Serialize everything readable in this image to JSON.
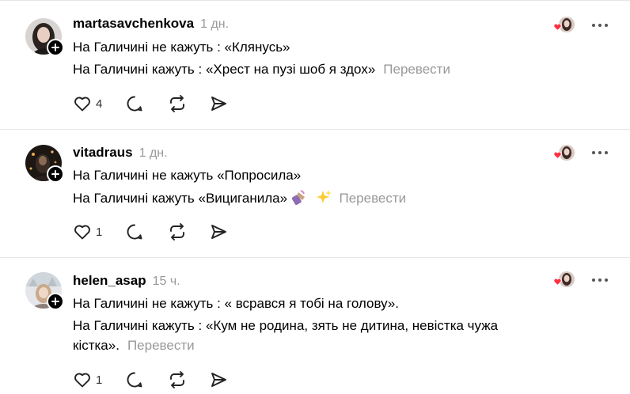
{
  "posts": [
    {
      "username": "martasavchenkova",
      "time": "1 дн.",
      "lines": [
        "На Галичині не кажуть : «Клянусь»",
        "На Галичині кажуть : «Хрест на пузі шоб я здох»"
      ],
      "translate_label": "Перевести",
      "like_count": "4",
      "avatar_icon": "avatar-photo-woman-dark-hair"
    },
    {
      "username": "vitadraus",
      "time": "1 дн.",
      "lines": [
        "На Галичині не кажуть «Попросила»",
        "На Галичині кажуть «Вициганила»"
      ],
      "line_emojis": [
        "nail-polish-emoji",
        "sparkles-emoji"
      ],
      "translate_label": "Перевести",
      "like_count": "1",
      "avatar_icon": "avatar-photo-dark-lights"
    },
    {
      "username": "helen_asap",
      "time": "15 ч.",
      "lines": [
        "На Галичині не кажуть : « всрався я тобі на голову».",
        "На Галичині кажуть : «Кум не родина, зять не дитина, невістка чужа",
        "кістка»."
      ],
      "translate_label": "Перевести",
      "like_count": "1",
      "avatar_icon": "avatar-photo-woman-light"
    }
  ],
  "icons": {
    "like": "heart-icon",
    "reply": "comment-icon",
    "repost": "repost-icon",
    "share": "send-icon",
    "more": "more-horizontal-icon",
    "follow": "plus-icon",
    "reactions": "liked-by-avatar-heart-icon"
  },
  "colors": {
    "heart_red": "#ff3040",
    "muted_text": "#999999",
    "separator": "#e6e6e6"
  }
}
